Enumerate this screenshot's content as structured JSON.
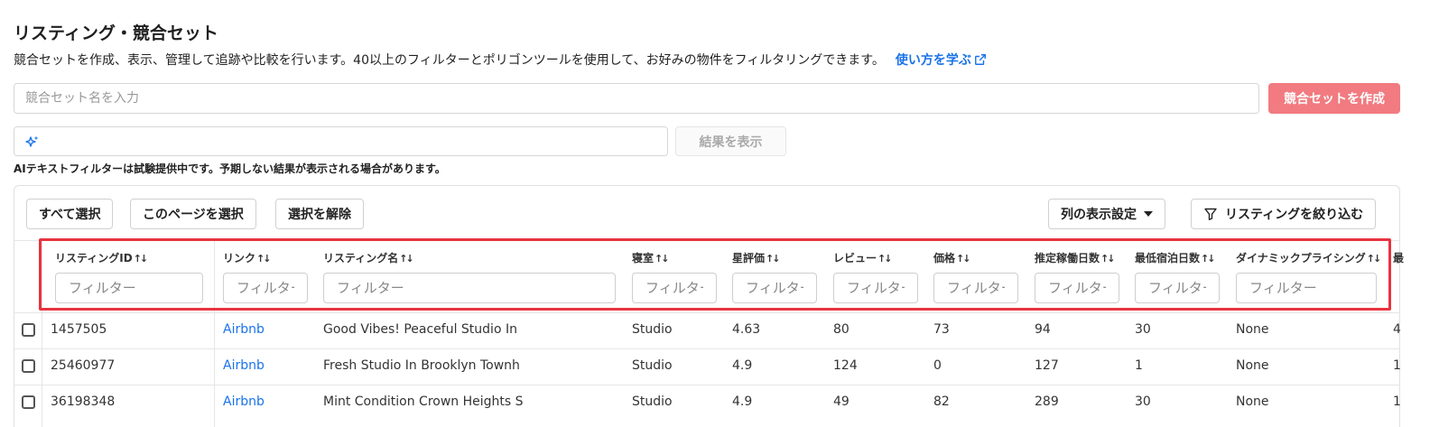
{
  "page": {
    "title": "リスティング・競合セット",
    "description": "競合セットを作成、表示、管理して追跡や比較を行います。40以上のフィルターとポリゴンツールを使用して、お好みの物件をフィルタリングできます。",
    "learn_link": "使い方を学ぶ"
  },
  "create": {
    "name_placeholder": "競合セット名を入力",
    "create_button": "競合セットを作成"
  },
  "ai": {
    "input_value": "",
    "show_results_button": "結果を表示",
    "note": "AIテキストフィルターは試験提供中です。予期しない結果が表示される場合があります。"
  },
  "toolbar": {
    "select_all": "すべて選択",
    "select_page": "このページを選択",
    "deselect": "選択を解除",
    "column_settings": "列の表示設定",
    "filter_listings": "リスティングを絞り込む"
  },
  "table": {
    "filter_placeholder": "フィルター",
    "columns": [
      "リスティングID",
      "リンク",
      "リスティング名",
      "寝室",
      "星評価",
      "レビュー",
      "価格",
      "推定稼働日数",
      "最低宿泊日数",
      "ダイナミックプライシング",
      "最"
    ],
    "rows": [
      [
        "1457505",
        "Airbnb",
        "Good Vibes! Peaceful Studio In",
        "Studio",
        "4.63",
        "80",
        "73",
        "94",
        "30",
        "None",
        "4"
      ],
      [
        "25460977",
        "Airbnb",
        "Fresh Studio In Brooklyn Townh",
        "Studio",
        "4.9",
        "124",
        "0",
        "127",
        "1",
        "None",
        "1"
      ],
      [
        "36198348",
        "Airbnb",
        "Mint Condition Crown Heights S",
        "Studio",
        "4.9",
        "49",
        "82",
        "289",
        "30",
        "None",
        "1"
      ]
    ]
  },
  "colors": {
    "accent_link": "#1a73e8",
    "create_button_bg": "#f17b80",
    "highlight_border": "#e8333f"
  },
  "icons": {
    "learn": "external-link-icon",
    "ai": "sparkle-icon",
    "column_settings": "caret-down-icon",
    "filter": "funnel-icon",
    "sort": "sort-arrows-icon"
  }
}
